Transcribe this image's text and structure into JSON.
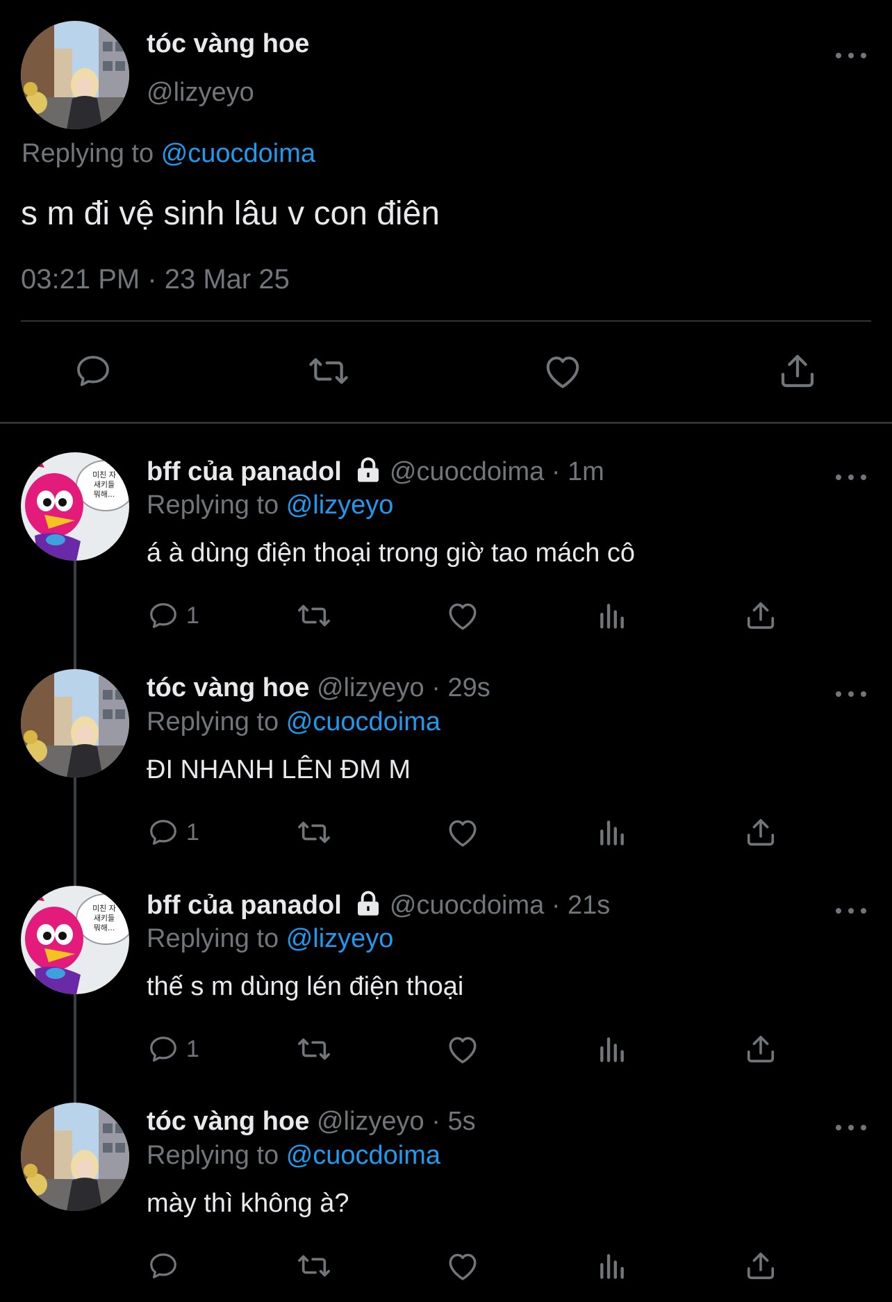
{
  "main_tweet": {
    "display_name": "tóc vàng hoe",
    "handle": "@lizyeyo",
    "replying_prefix": "Replying to",
    "replying_to": "@cuocdoima",
    "text": "s m đi vệ sinh lâu v con điên",
    "timestamp": "03:21 PM · 23 Mar 25",
    "avatar_icon": "blonde-girl-street-avatar",
    "more_icon": "more-horizontal-icon",
    "actions": [
      "reply-icon",
      "retweet-icon",
      "like-icon",
      "share-icon"
    ]
  },
  "replies": [
    {
      "display_name": "bff của panadol",
      "locked": true,
      "handle": "@cuocdoima",
      "time": "· 1m",
      "replying_prefix": "Replying to",
      "replying_to": "@lizyeyo",
      "text": "á à dùng điện thoại trong giờ tao mách cô",
      "reply_count": "1",
      "avatar_icon": "pink-bird-avatar"
    },
    {
      "display_name": "tóc vàng hoe",
      "locked": false,
      "handle": "@lizyeyo",
      "time": "· 29s",
      "replying_prefix": "Replying to",
      "replying_to": "@cuocdoima",
      "text": "ĐI NHANH LÊN ĐM M",
      "reply_count": "1",
      "avatar_icon": "blonde-girl-street-avatar"
    },
    {
      "display_name": "bff của panadol",
      "locked": true,
      "handle": "@cuocdoima",
      "time": "· 21s",
      "replying_prefix": "Replying to",
      "replying_to": "@lizyeyo",
      "text": "thế s m dùng lén điện thoại",
      "reply_count": "1",
      "avatar_icon": "pink-bird-avatar"
    },
    {
      "display_name": "tóc vàng hoe",
      "locked": false,
      "handle": "@lizyeyo",
      "time": "· 5s",
      "replying_prefix": "Replying to",
      "replying_to": "@cuocdoima",
      "text": "mày thì không à?",
      "reply_count": "",
      "avatar_icon": "blonde-girl-street-avatar"
    }
  ],
  "bird_speech_text": "미친 자\n새키들\n뭐해...",
  "colors": {
    "background": "#000000",
    "text": "#e7e9ea",
    "secondary": "#71767b",
    "accent": "#1d9bf0",
    "divider": "#2f3336"
  }
}
